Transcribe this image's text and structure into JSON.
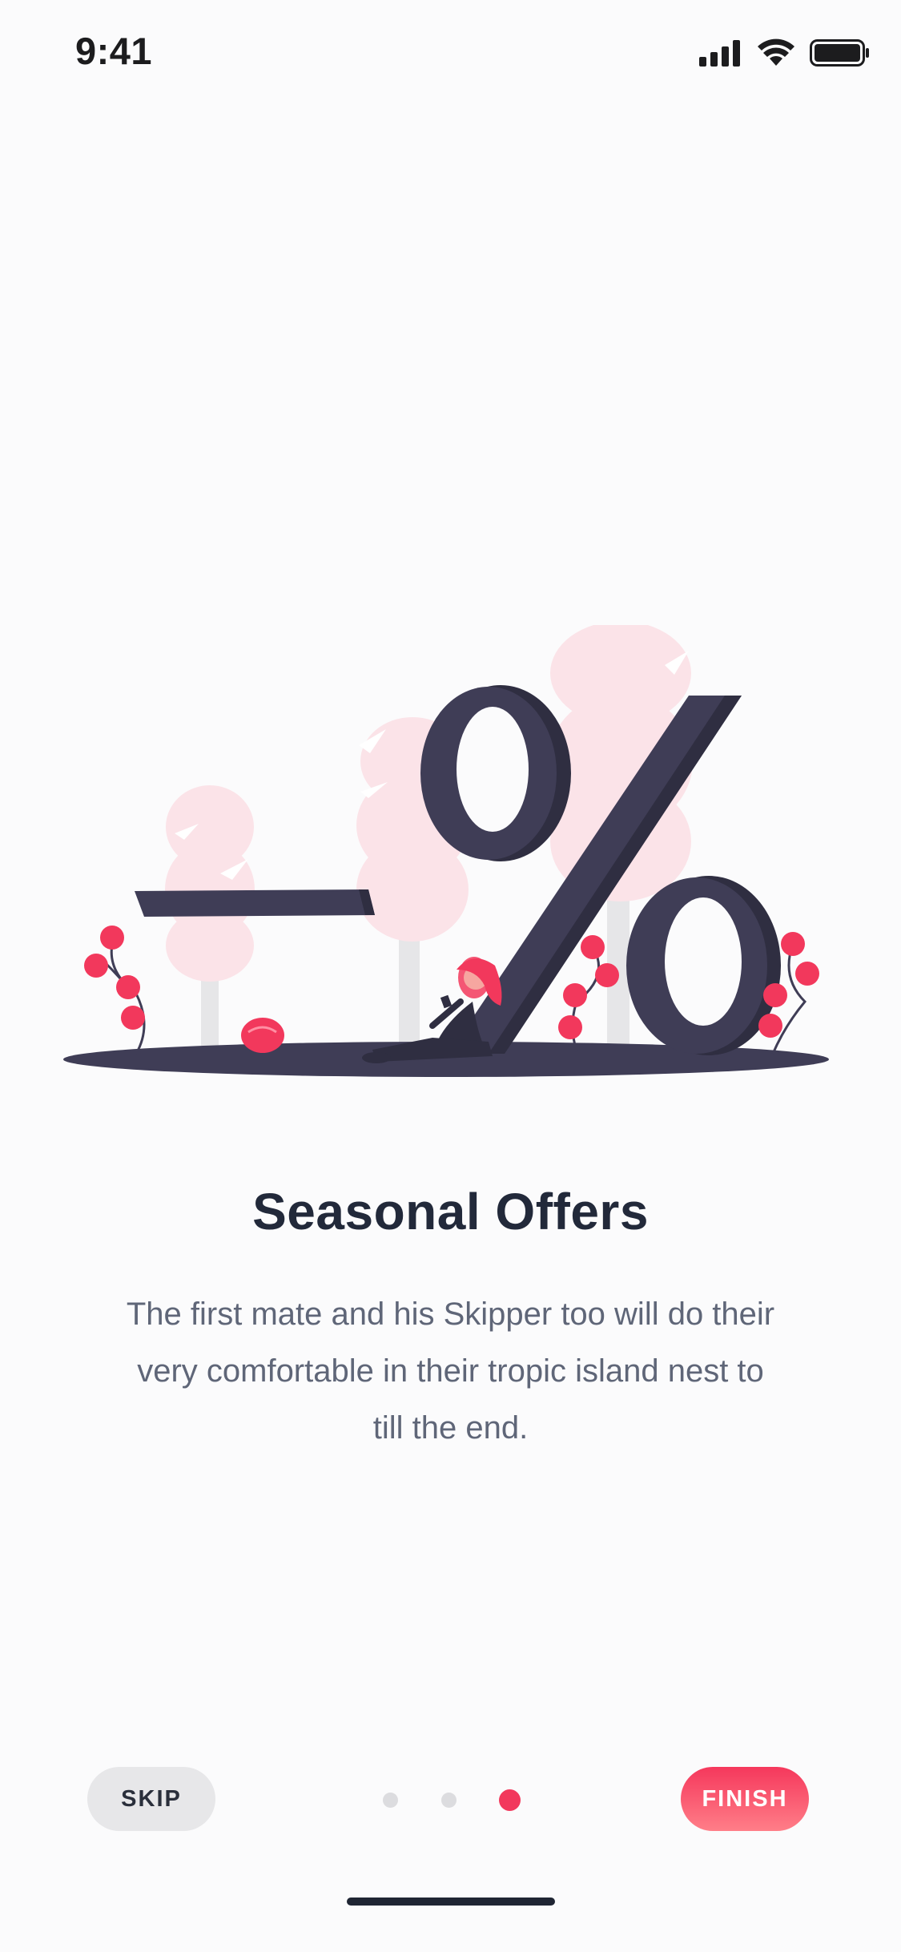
{
  "status_bar": {
    "time": "9:41",
    "icons": [
      "cellular-signal-icon",
      "wifi-icon",
      "battery-icon"
    ]
  },
  "illustration": {
    "name": "discount-percent-illustration",
    "colors": {
      "dark": "#3f3d56",
      "pink_tree": "#fbe3e8",
      "accent": "#f2385c"
    }
  },
  "onboarding": {
    "title": "Seasonal Offers",
    "description": "The first mate and his Skipper too will do their very comfortable in their tropic island nest to till the end.",
    "page_indicator": {
      "total": 3,
      "current": 3
    }
  },
  "controls": {
    "skip_label": "SKIP",
    "finish_label": "FINISH"
  },
  "theme": {
    "accent": "#f2385c",
    "accent_light": "#ff7e88",
    "text_primary": "#22293a",
    "text_secondary": "#5f6678"
  }
}
